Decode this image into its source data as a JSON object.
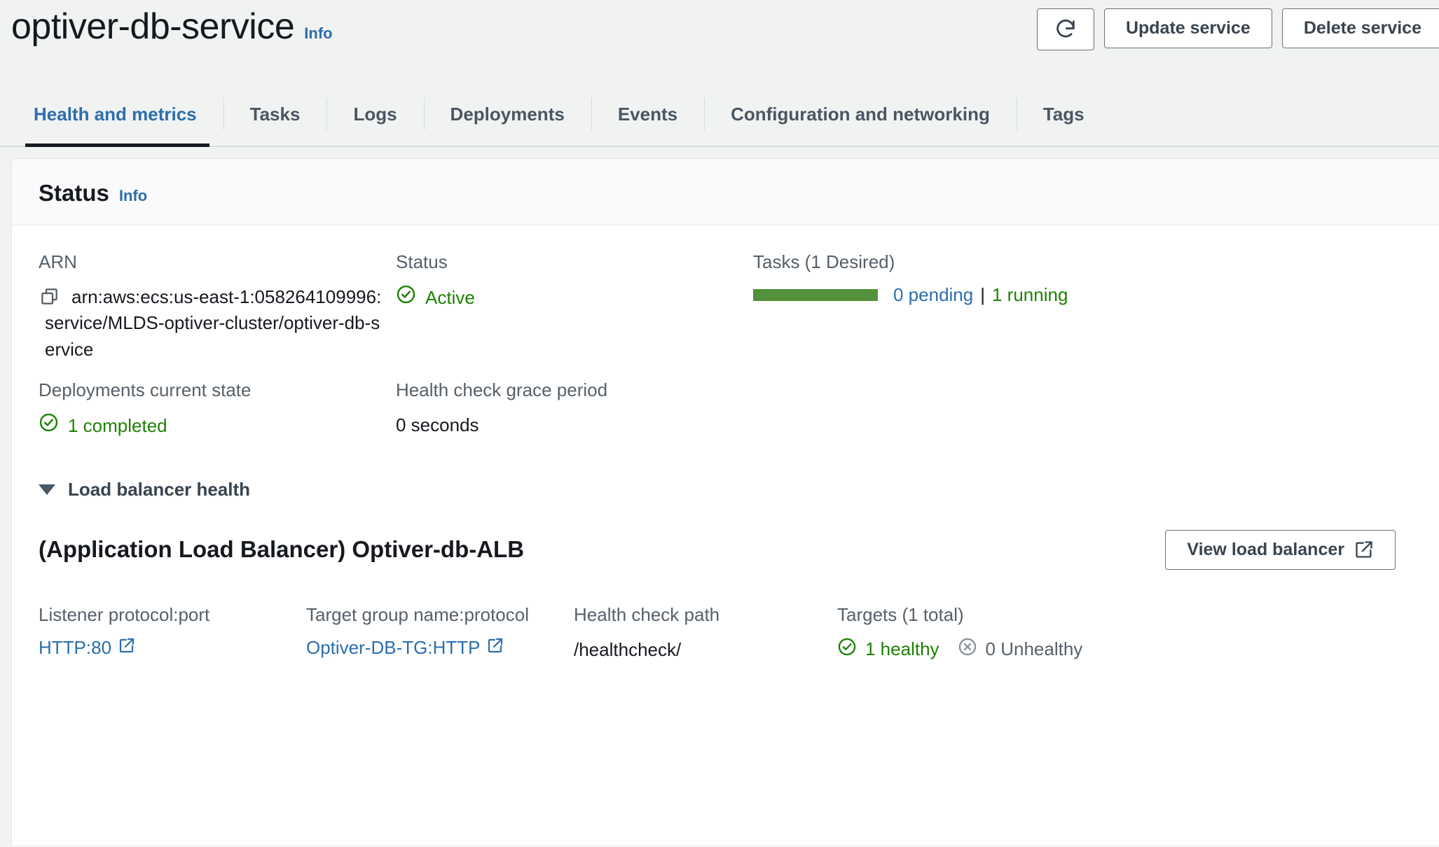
{
  "header": {
    "title": "optiver-db-service",
    "info_label": "Info",
    "actions": {
      "refresh_icon": "refresh-icon",
      "update_label": "Update service",
      "delete_label": "Delete service"
    }
  },
  "tabs": [
    {
      "label": "Health and metrics",
      "active": true
    },
    {
      "label": "Tasks",
      "active": false
    },
    {
      "label": "Logs",
      "active": false
    },
    {
      "label": "Deployments",
      "active": false
    },
    {
      "label": "Events",
      "active": false
    },
    {
      "label": "Configuration and networking",
      "active": false
    },
    {
      "label": "Tags",
      "active": false
    }
  ],
  "status_panel": {
    "heading": "Status",
    "info_label": "Info",
    "fields": {
      "arn_label": "ARN",
      "arn_value": "arn:aws:ecs:us-east-1:058264109996:service/MLDS-optiver-cluster/optiver-db-service",
      "copy_icon": "copy-icon",
      "status_label": "Status",
      "status_value": "Active",
      "tasks_label": "Tasks (1 Desired)",
      "tasks_pending": "0 pending",
      "tasks_separator": "|",
      "tasks_running": "1 running",
      "tasks_progress_percent": 100,
      "deployments_label": "Deployments current state",
      "deployments_value": "1 completed",
      "grace_label": "Health check grace period",
      "grace_value": "0 seconds"
    }
  },
  "load_balancer": {
    "section_label": "Load balancer health",
    "name": "(Application Load Balancer) Optiver-db-ALB",
    "view_button_label": "View load balancer",
    "fields": {
      "listener_label": "Listener protocol:port",
      "listener_value": "HTTP:80",
      "target_group_label": "Target group name:protocol",
      "target_group_value": "Optiver-DB-TG:HTTP",
      "health_path_label": "Health check path",
      "health_path_value": "/healthcheck/",
      "targets_label": "Targets (1 total)",
      "targets_healthy": "1 healthy",
      "targets_unhealthy": "0 Unhealthy"
    }
  },
  "colors": {
    "accent_link": "#2c6eac",
    "success_green": "#1d8102",
    "progress_green": "#53913b",
    "page_bg": "#f1f3f3",
    "text_muted": "#57606a"
  }
}
